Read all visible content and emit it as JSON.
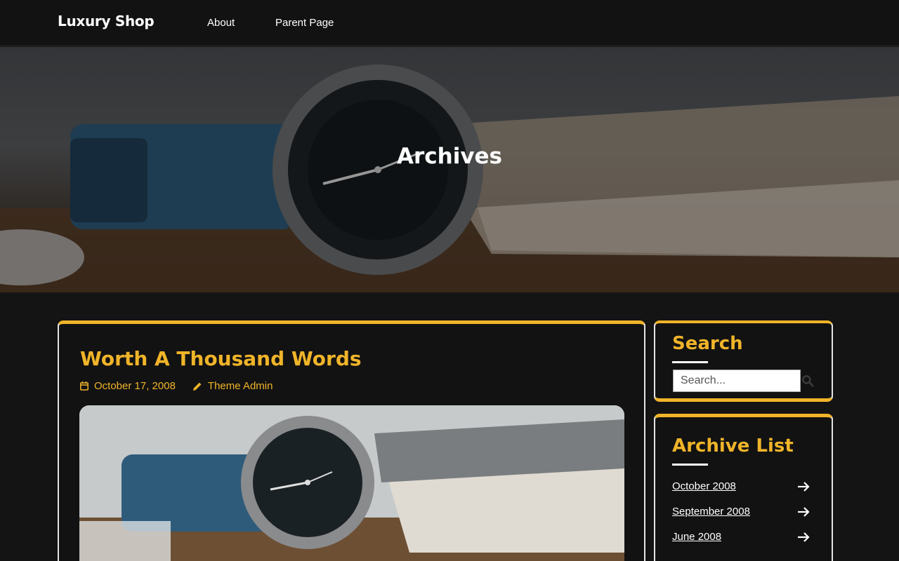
{
  "header": {
    "site_title": "Luxury Shop",
    "nav": [
      "About",
      "Parent Page"
    ]
  },
  "hero": {
    "title": "Archives"
  },
  "post": {
    "title": "Worth A Thousand Words",
    "date": "October 17, 2008",
    "author": "Theme Admin"
  },
  "sidebar": {
    "search": {
      "title": "Search",
      "placeholder": "Search..."
    },
    "archive": {
      "title": "Archive List",
      "items": [
        "October 2008",
        "September 2008",
        "June 2008"
      ]
    }
  },
  "colors": {
    "accent": "#f0b429",
    "background": "#141414"
  }
}
